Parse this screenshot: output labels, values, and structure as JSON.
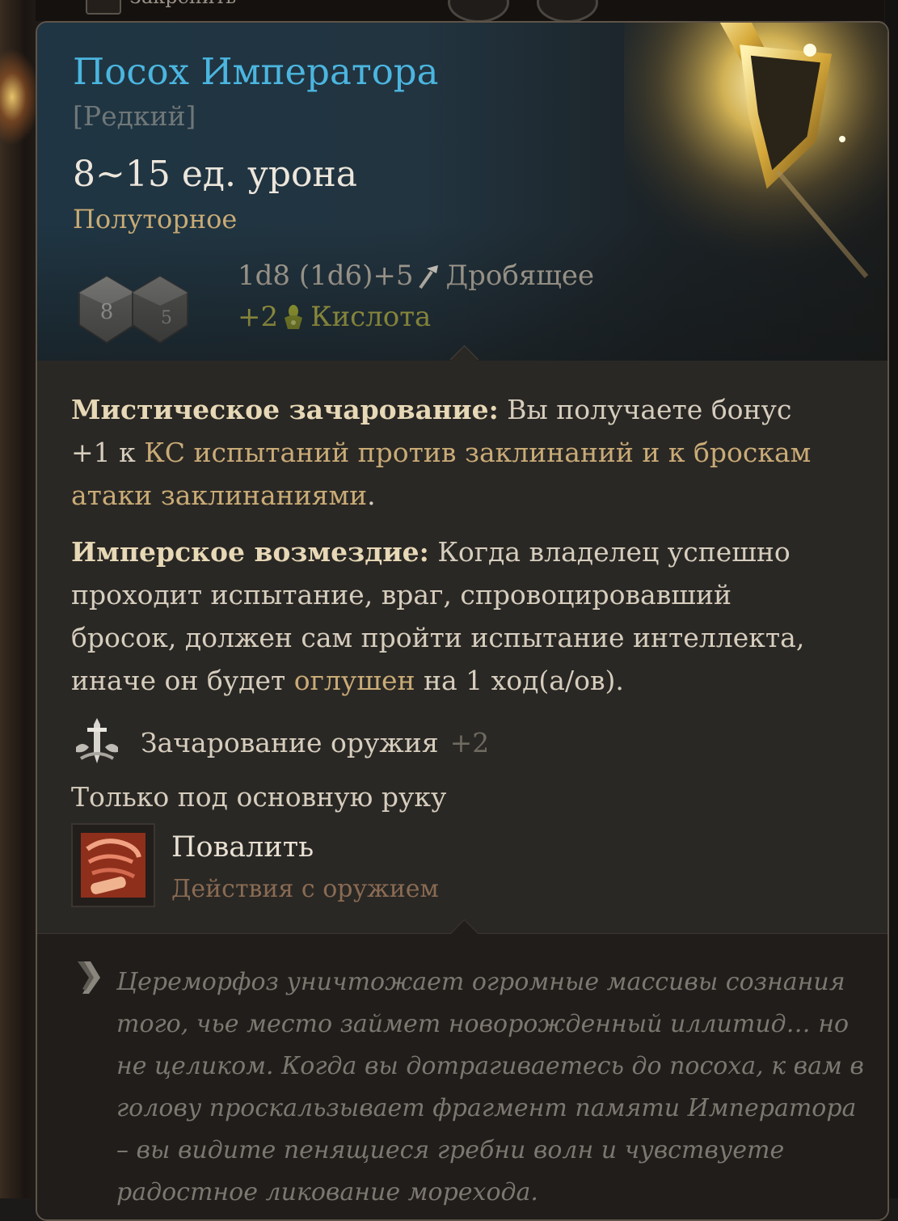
{
  "top": {
    "pin_label": "Закрепить"
  },
  "item": {
    "name": "Посох Императора",
    "rarity": "[Редкий]",
    "damage_summary": "8~15 ед. урона",
    "weapon_property": "Полуторное",
    "damage_line": "1d8 (1d6)+5",
    "damage_type": "Дробящее",
    "bonus_value": "+2",
    "bonus_type": "Кислота",
    "dice": [
      "8",
      "5"
    ]
  },
  "effects": [
    {
      "name": "Мистическое зачарование:",
      "text_a": " Вы получаете бонус +1 к ",
      "highlight": "КС испытаний против заклинаний и к броскам атаки заклинаниями",
      "text_b": "."
    },
    {
      "name": "Имперское возмездие:",
      "text_a": " Когда владелец успешно проходит испытание, враг, спровоцировавший бросок, должен сам пройти испытание интеллекта, иначе он будет ",
      "highlight": "оглушен",
      "text_b": " на 1 ход(а/ов)."
    }
  ],
  "enchantment": {
    "label": "Зачарование оружия",
    "value": "+2"
  },
  "hand_restriction": "Только под основную руку",
  "action": {
    "title": "Повалить",
    "subtitle": "Действия с оружием"
  },
  "lore": "Цереморфоз уничтожает огромные массивы сознания того, чье место займет новорожденный иллитид… но не целиком. Когда вы дотрагиваетесь до посоха, к вам в голову проскальзывает фрагмент памяти Императора – вы видите пенящиеся гребни волн и чувствуете радостное ликование морехода.",
  "colors": {
    "title": "#4bb6e0",
    "weapon_property": "#c9ab76",
    "acid_bonus": "#c8c650",
    "action_subtitle": "#8a6b53"
  }
}
